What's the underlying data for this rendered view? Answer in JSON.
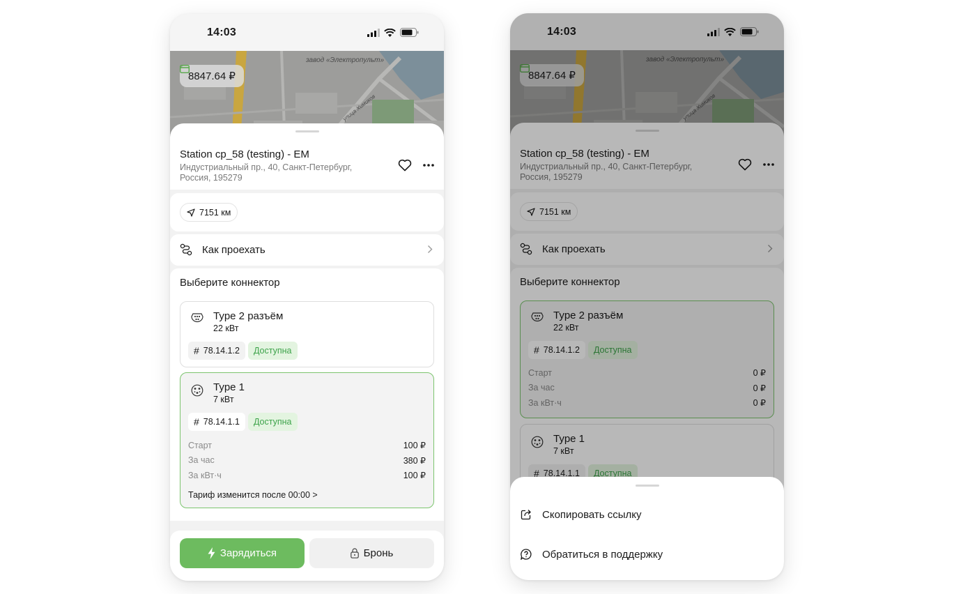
{
  "status_bar": {
    "time": "14:03"
  },
  "map": {
    "label": "завод «Электропульт»",
    "street": "улица Химиков"
  },
  "balance": {
    "amount": "8847.64 ₽"
  },
  "station": {
    "title": "Station cp_58 (testing) - EM",
    "address": "Индустриальный пр., 40, Санкт-Петербург, Россия, 195279"
  },
  "distance": "7151 км",
  "route": {
    "label": "Как проехать"
  },
  "connectors_heading": "Выберите коннектор",
  "phone1": {
    "connectors": [
      {
        "name": "Type 2 разъём",
        "power": "22 кВт",
        "id": "78.14.1.2",
        "status": "Доступна",
        "selected": false
      },
      {
        "name": "Type 1",
        "power": "7 кВт",
        "id": "78.14.1.1",
        "status": "Доступна",
        "selected": true,
        "prices": [
          {
            "label": "Старт",
            "value": "100 ₽"
          },
          {
            "label": "За час",
            "value": "380 ₽"
          },
          {
            "label": "За кВт·ч",
            "value": "100 ₽"
          }
        ],
        "tariff_note": "Тариф изменится после 00:00 >"
      }
    ]
  },
  "phone2": {
    "connectors": [
      {
        "name": "Type 2 разъём",
        "power": "22 кВт",
        "id": "78.14.1.2",
        "status": "Доступна",
        "selected": true,
        "prices": [
          {
            "label": "Старт",
            "value": "0 ₽"
          },
          {
            "label": "За час",
            "value": "0 ₽"
          },
          {
            "label": "За кВт·ч",
            "value": "0 ₽"
          }
        ]
      },
      {
        "name": "Type 1",
        "power": "7 кВт",
        "id": "78.14.1.1",
        "status": "Доступна",
        "selected": false
      }
    ]
  },
  "actions": {
    "charge_label": "Зарядиться",
    "book_label": "Бронь"
  },
  "menu": {
    "copy_link": "Скопировать ссылку",
    "support": "Обратиться в поддержку"
  },
  "colors": {
    "accent": "#6dbb5f",
    "status_green": "#3da34a",
    "status_bg": "#e3f4e0",
    "selected_border": "#7cc46e"
  }
}
